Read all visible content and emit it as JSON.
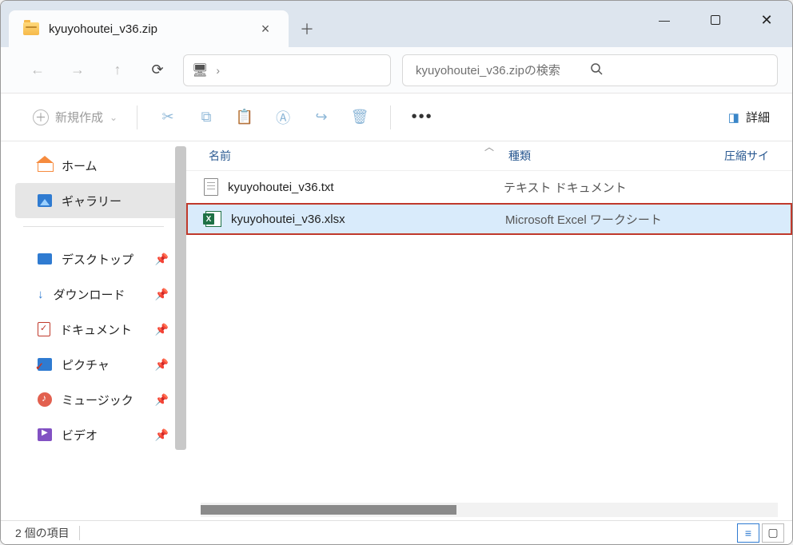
{
  "tab": {
    "title": "kyuyohoutei_v36.zip"
  },
  "search": {
    "placeholder": "kyuyohoutei_v36.zipの検索"
  },
  "toolbar": {
    "new_label": "新規作成",
    "details_label": "詳細"
  },
  "sidebar": {
    "home": "ホーム",
    "gallery": "ギャラリー",
    "desktop": "デスクトップ",
    "downloads": "ダウンロード",
    "documents": "ドキュメント",
    "pictures": "ピクチャ",
    "music": "ミュージック",
    "videos": "ビデオ"
  },
  "columns": {
    "name": "名前",
    "type": "種類",
    "compressed_size": "圧縮サイ"
  },
  "files": [
    {
      "name": "kyuyohoutei_v36.txt",
      "type": "テキスト ドキュメント"
    },
    {
      "name": "kyuyohoutei_v36.xlsx",
      "type": "Microsoft Excel ワークシート"
    }
  ],
  "status": {
    "item_count": "2 個の項目"
  }
}
